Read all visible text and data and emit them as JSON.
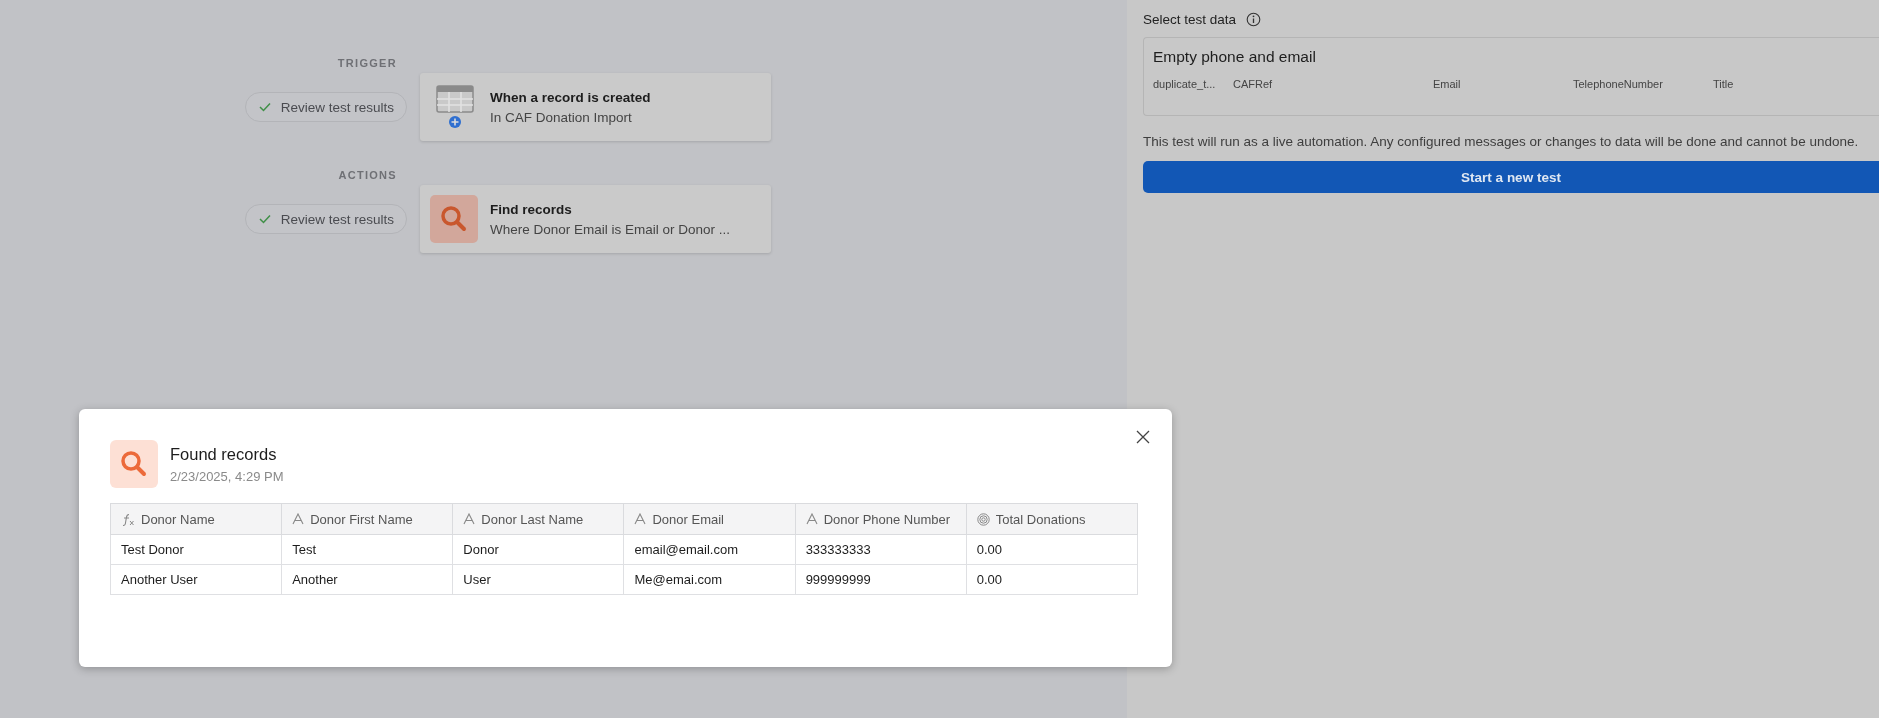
{
  "flow": {
    "steps": [
      {
        "section": "TRIGGER",
        "review": "Review test results",
        "reviewed": true,
        "kind": "table",
        "title": "When a record is created",
        "subtitle": "In CAF Donation Import"
      },
      {
        "section": "ACTIONS",
        "review": "Review test results",
        "reviewed": true,
        "kind": "search",
        "title": "Find records",
        "subtitle": "Where Donor Email is Email or Donor ..."
      }
    ]
  },
  "test_panel": {
    "heading": "Select test data",
    "record": {
      "title": "Empty phone and email",
      "fields": [
        "duplicate_t...",
        "CAFRef",
        "Email",
        "TelephoneNumber",
        "Title"
      ]
    },
    "note": "This test will run as a live automation. Any configured messages or changes to data will be done and cannot be undone.",
    "button": "Start a new test"
  },
  "dialog": {
    "title": "Found records",
    "timestamp": "2/23/2025, 4:29 PM",
    "columns": [
      {
        "label": "Donor Name",
        "kind": "formula"
      },
      {
        "label": "Donor First Name",
        "kind": "text"
      },
      {
        "label": "Donor Last Name",
        "kind": "text"
      },
      {
        "label": "Donor Email",
        "kind": "text"
      },
      {
        "label": "Donor Phone Number",
        "kind": "text"
      },
      {
        "label": "Total Donations",
        "kind": "rollup"
      }
    ],
    "rows": [
      [
        "Test Donor",
        "Test",
        "Donor",
        "email@email.com",
        "333333333",
        "0.00"
      ],
      [
        "Another User",
        "Another",
        "User",
        "Me@emai.com",
        "999999999",
        "0.00"
      ]
    ]
  }
}
